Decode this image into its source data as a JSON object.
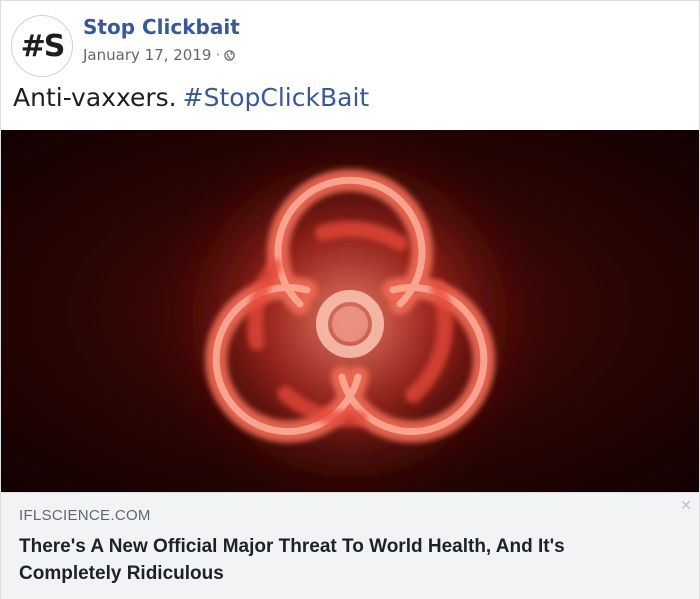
{
  "post": {
    "page_name": "Stop Clickbait",
    "avatar_text": "#S",
    "date": "January 17, 2019",
    "separator": "·",
    "privacy_icon": "globe-icon",
    "text": "Anti-vaxxers.",
    "hashtag": "#StopClickBait"
  },
  "link_preview": {
    "image_icon": "biohazard-icon",
    "domain": "IFLSCIENCE.COM",
    "headline": "There's A New Official Major Threat To World Health, And It's Completely Ridiculous",
    "close_glyph": "✕"
  },
  "colors": {
    "link_blue": "#385898",
    "preview_bg": "#f2f3f5",
    "biohazard_red": "#d83a2a"
  }
}
